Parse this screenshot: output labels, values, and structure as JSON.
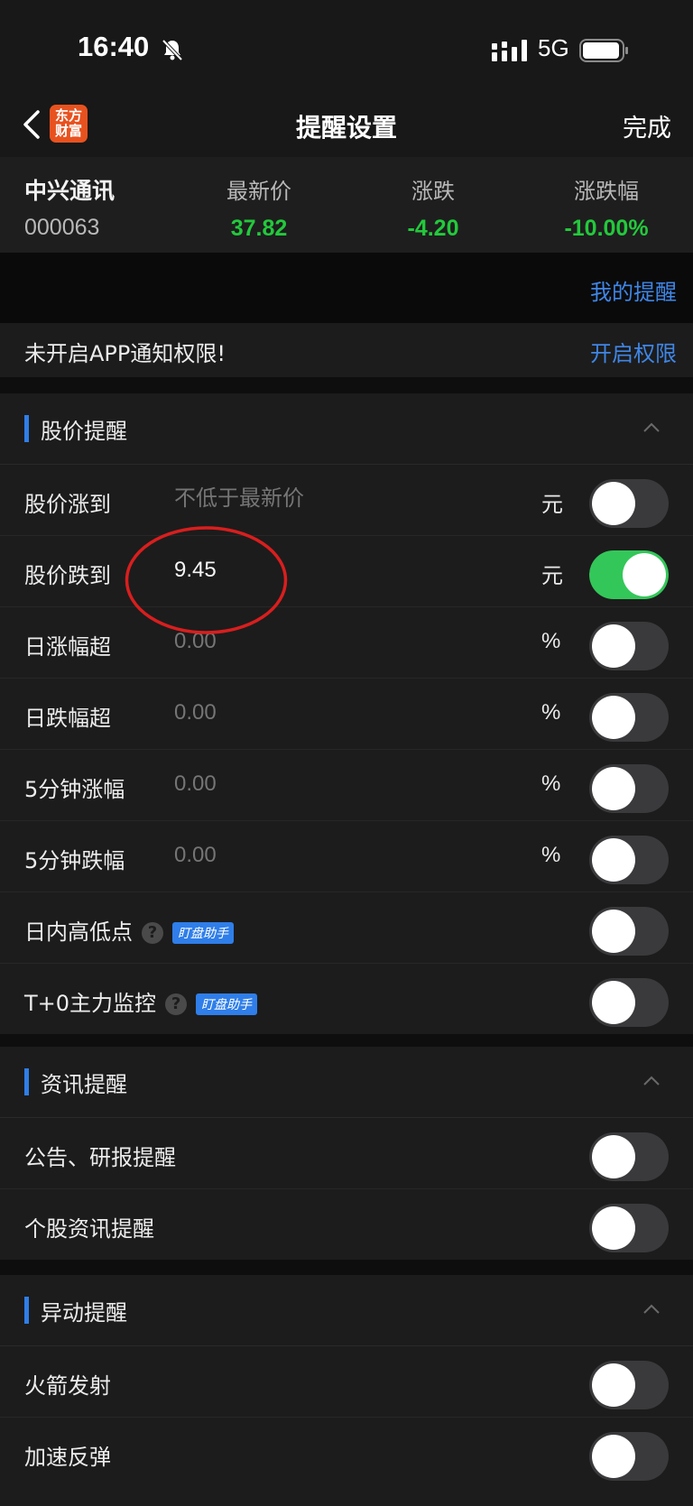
{
  "status_bar": {
    "time": "16:40",
    "network": "5G"
  },
  "nav": {
    "logo_line1": "东方",
    "logo_line2": "财富",
    "title": "提醒设置",
    "done": "完成"
  },
  "quote": {
    "name": "中兴通讯",
    "code": "000063",
    "columns": [
      {
        "label": "最新价",
        "value": "37.82"
      },
      {
        "label": "涨跌",
        "value": "-4.20"
      },
      {
        "label": "涨跌幅",
        "value": "-10.00%"
      }
    ],
    "value_color": "#23c93c"
  },
  "my_alerts": "我的提醒",
  "notice": {
    "text": "未开启APP通知权限!",
    "link": "开启权限"
  },
  "price_section": {
    "title": "股价提醒",
    "rows": [
      {
        "label": "股价涨到",
        "value": "",
        "placeholder": "不低于最新价",
        "unit": "元",
        "on": false
      },
      {
        "label": "股价跌到",
        "value": "9.45",
        "placeholder": "",
        "unit": "元",
        "on": true
      },
      {
        "label": "日涨幅超",
        "value": "",
        "placeholder": "0.00",
        "unit": "%",
        "on": false
      },
      {
        "label": "日跌幅超",
        "value": "",
        "placeholder": "0.00",
        "unit": "%",
        "on": false
      },
      {
        "label": "5分钟涨幅",
        "value": "",
        "placeholder": "0.00",
        "unit": "%",
        "on": false
      },
      {
        "label": "5分钟跌幅",
        "value": "",
        "placeholder": "0.00",
        "unit": "%",
        "on": false
      },
      {
        "label": "日内高低点",
        "help": "?",
        "badge": "盯盘助手",
        "on": false
      },
      {
        "label": "T+0主力监控",
        "help": "?",
        "badge": "盯盘助手",
        "on": false
      }
    ]
  },
  "news_section": {
    "title": "资讯提醒",
    "rows": [
      {
        "label": "公告、研报提醒",
        "on": false
      },
      {
        "label": "个股资讯提醒",
        "on": false
      }
    ]
  },
  "anomaly_section": {
    "title": "异动提醒",
    "rows": [
      {
        "label": "火箭发射",
        "on": false
      },
      {
        "label": "加速反弹",
        "on": false
      }
    ]
  },
  "colors": {
    "accent": "#2f7ee9",
    "toggle_on": "#33c759",
    "annotation": "#d91e1e"
  }
}
